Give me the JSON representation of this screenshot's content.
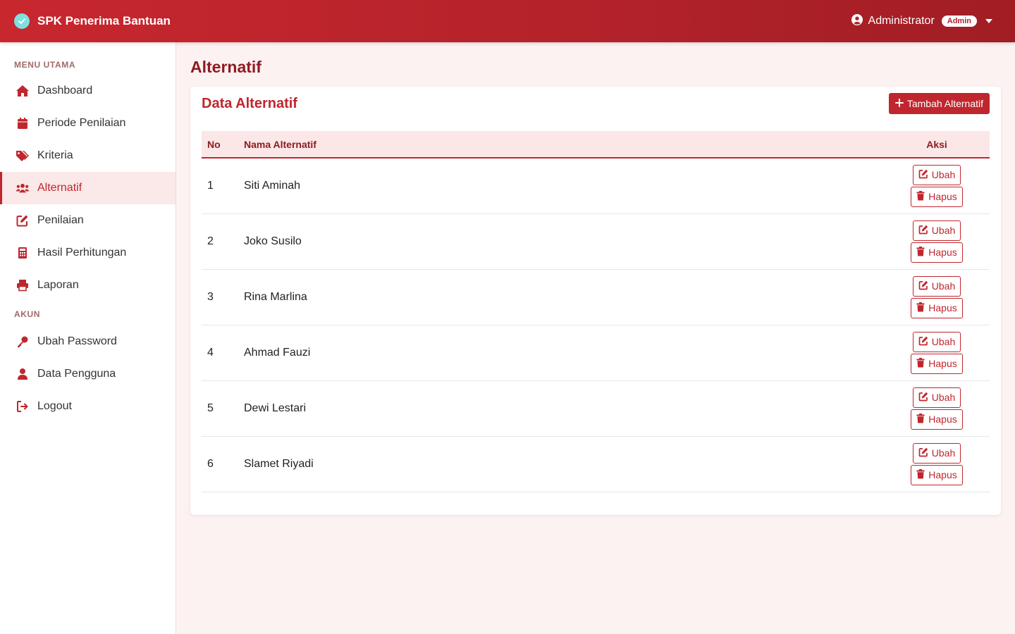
{
  "header": {
    "brand": "SPK Penerima Bantuan",
    "user_name": "Administrator",
    "role_badge": "Admin"
  },
  "sidebar": {
    "menu_title": "MENU UTAMA",
    "menu_items": [
      {
        "label": "Dashboard",
        "icon": "home-icon"
      },
      {
        "label": "Periode Penilaian",
        "icon": "calendar-icon"
      },
      {
        "label": "Kriteria",
        "icon": "tags-icon"
      },
      {
        "label": "Alternatif",
        "icon": "users-icon",
        "active": true
      },
      {
        "label": "Penilaian",
        "icon": "edit-icon"
      },
      {
        "label": "Hasil Perhitungan",
        "icon": "calculator-icon"
      },
      {
        "label": "Laporan",
        "icon": "printer-icon"
      }
    ],
    "akun_title": "AKUN",
    "akun_items": [
      {
        "label": "Ubah Password",
        "icon": "key-icon"
      },
      {
        "label": "Data Pengguna",
        "icon": "user-icon"
      },
      {
        "label": "Logout",
        "icon": "logout-icon"
      }
    ]
  },
  "main": {
    "page_title": "Alternatif",
    "card_title": "Data Alternatif",
    "add_button": "Tambah Alternatif",
    "table": {
      "headers": [
        "No",
        "Nama Alternatif",
        "Aksi"
      ],
      "rows": [
        {
          "no": "1",
          "name": "Siti Aminah"
        },
        {
          "no": "2",
          "name": "Joko Susilo"
        },
        {
          "no": "3",
          "name": "Rina Marlina"
        },
        {
          "no": "4",
          "name": "Ahmad Fauzi"
        },
        {
          "no": "5",
          "name": "Dewi Lestari"
        },
        {
          "no": "6",
          "name": "Slamet Riyadi"
        }
      ],
      "edit_label": "Ubah",
      "delete_label": "Hapus"
    }
  },
  "colors": {
    "primary": "#c0262d",
    "header_bg": "#b3222a",
    "page_bg": "#fcf2f2"
  }
}
